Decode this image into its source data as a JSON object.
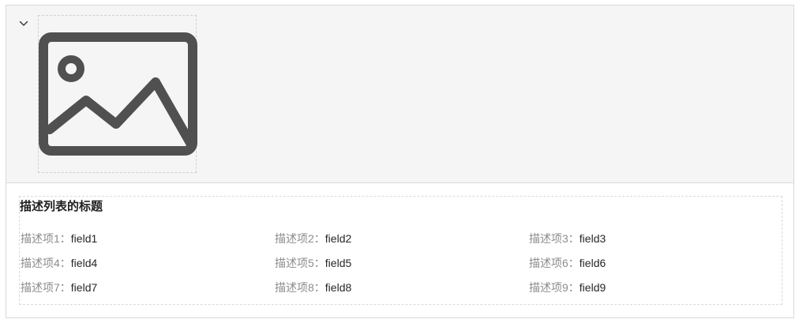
{
  "description": {
    "title": "描述列表的标题",
    "items": [
      {
        "label": "描述项1：",
        "value": "field1"
      },
      {
        "label": "描述项2：",
        "value": "field2"
      },
      {
        "label": "描述项3：",
        "value": "field3"
      },
      {
        "label": "描述项4：",
        "value": "field4"
      },
      {
        "label": "描述项5：",
        "value": "field5"
      },
      {
        "label": "描述项6：",
        "value": "field6"
      },
      {
        "label": "描述项7：",
        "value": "field7"
      },
      {
        "label": "描述项8：",
        "value": "field8"
      },
      {
        "label": "描述项9：",
        "value": "field9"
      }
    ]
  },
  "icons": {
    "toggle": "chevron-down-icon",
    "placeholder": "image-placeholder-icon"
  },
  "colors": {
    "media_background": "#f5f5f5",
    "icon": "#505050",
    "label": "#8c8c8c",
    "value": "#262626",
    "border": "#d9d9d9"
  }
}
